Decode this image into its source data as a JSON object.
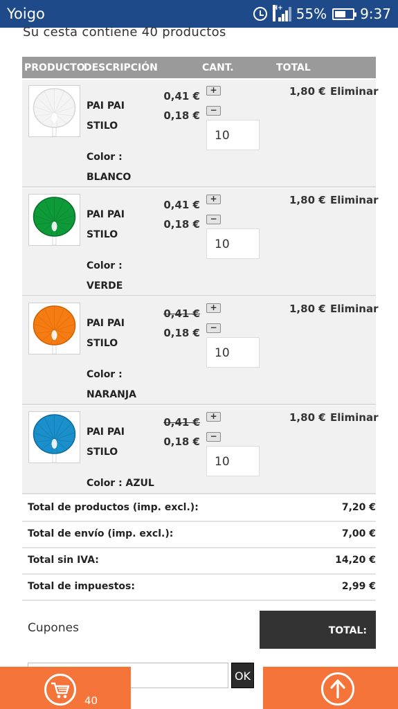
{
  "status_bar": {
    "carrier": "Yoigo",
    "network": "H+",
    "battery": "55%",
    "time": "9:37"
  },
  "cart_summary": "Su cesta contiene 40 productos",
  "table_header": {
    "product": "PRODUCTO",
    "description": "DESCRIPCIÓN",
    "quantity": "CANT.",
    "total": "TOTAL"
  },
  "items": [
    {
      "name_line1": "PAI PAI",
      "name_line2": "STILO",
      "color_label": "Color :",
      "color_value": "BLANCO",
      "old_price": "0,41 €",
      "new_price": "0,18 €",
      "old_price_struck": false,
      "quantity": "10",
      "total": "1,80 €",
      "remove": "Eliminar",
      "plus": "+",
      "minus": "−",
      "fan_color": "#f4f4f4",
      "fan_edge": "#d6d6d6",
      "image_icon": "white-fan-image"
    },
    {
      "name_line1": "PAI PAI",
      "name_line2": "STILO",
      "color_label": "Color :",
      "color_value": "VERDE",
      "old_price": "0,41 €",
      "new_price": "0,18 €",
      "old_price_struck": false,
      "quantity": "10",
      "total": "1,80 €",
      "remove": "Eliminar",
      "plus": "+",
      "minus": "−",
      "fan_color": "#0f9a3a",
      "fan_edge": "#06702a",
      "image_icon": "green-fan-image"
    },
    {
      "name_line1": "PAI PAI",
      "name_line2": "STILO",
      "color_label": "Color :",
      "color_value": "NARANJA",
      "old_price": "0,41 €",
      "new_price": "0,18 €",
      "old_price_struck": true,
      "quantity": "10",
      "total": "1,80 €",
      "remove": "Eliminar",
      "plus": "+",
      "minus": "−",
      "fan_color": "#f47c12",
      "fan_edge": "#d05f00",
      "image_icon": "orange-fan-image"
    },
    {
      "name_line1": "PAI PAI",
      "name_line2": "STILO",
      "color_label": "Color : AZUL",
      "color_value": "",
      "old_price": "0,41 €",
      "new_price": "0,18 €",
      "old_price_struck": true,
      "quantity": "10",
      "total": "1,80 €",
      "remove": "Eliminar",
      "plus": "+",
      "minus": "−",
      "fan_color": "#1a8fc9",
      "fan_edge": "#0a6a9c",
      "image_icon": "blue-fan-image"
    }
  ],
  "totals": [
    {
      "label": "Total de productos (imp. excl.):",
      "value": "7,20 €"
    },
    {
      "label": "Total de envío (imp. excl.):",
      "value": "7,00 €"
    },
    {
      "label": "Total sin IVA:",
      "value": "14,20 €"
    },
    {
      "label": "Total de impuestos:",
      "value": "2,99 €"
    }
  ],
  "coupons_label": "Cupones",
  "total_box_label": "TOTAL:",
  "ok_button": "OK",
  "bottom_bar": {
    "cart_count": "40",
    "cart_icon": "shopping-cart-icon",
    "up_icon": "arrow-up-icon",
    "accent_color": "#f5743a"
  }
}
